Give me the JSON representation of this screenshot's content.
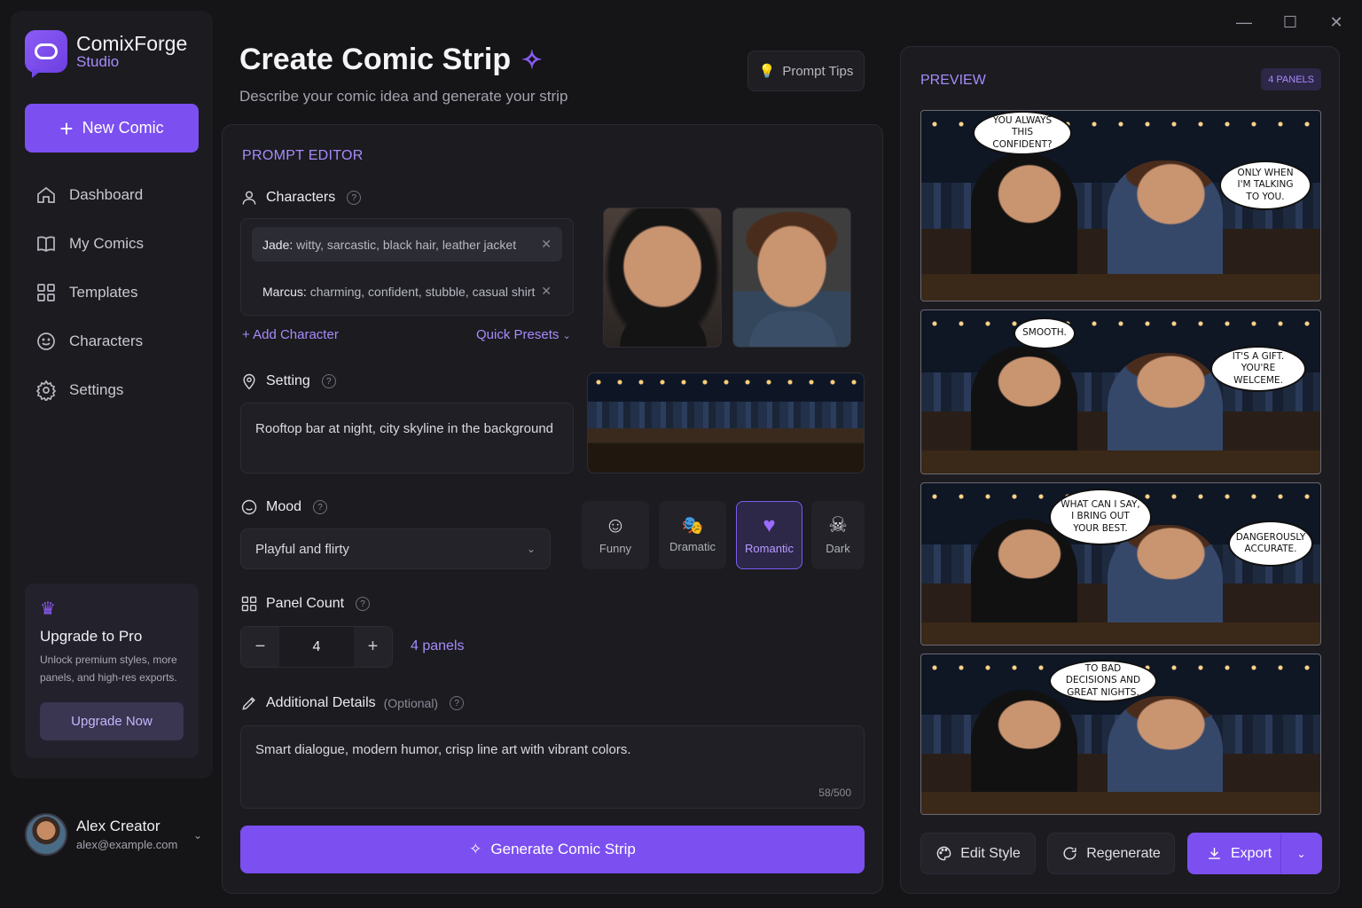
{
  "app": {
    "name": "ComixForge",
    "sub": "Studio"
  },
  "sidebar": {
    "new_label": "New Comic",
    "items": [
      {
        "label": "Dashboard",
        "icon": "home-icon"
      },
      {
        "label": "My Comics",
        "icon": "book-icon"
      },
      {
        "label": "Templates",
        "icon": "grid-icon"
      },
      {
        "label": "Characters",
        "icon": "smiley-icon"
      },
      {
        "label": "Settings",
        "icon": "gear-icon"
      }
    ],
    "upgrade": {
      "title": "Upgrade to Pro",
      "desc": "Unlock premium styles, more panels, and high-res exports.",
      "button": "Upgrade Now"
    },
    "user": {
      "name": "Alex Creator",
      "email": "alex@example.com"
    }
  },
  "header": {
    "title": "Create Comic Strip",
    "subtitle": "Describe your comic idea and generate your strip",
    "tips": "Prompt Tips"
  },
  "editor": {
    "title": "PROMPT EDITOR",
    "characters": {
      "label": "Characters",
      "list": [
        {
          "name": "Jade:",
          "desc": "witty, sarcastic, black hair, leather jacket"
        },
        {
          "name": "Marcus:",
          "desc": "charming, confident, stubble, casual shirt"
        }
      ],
      "add": "+ Add Character",
      "presets": "Quick Presets"
    },
    "setting": {
      "label": "Setting",
      "value": "Rooftop bar at night, city skyline in the background"
    },
    "mood": {
      "label": "Mood",
      "value": "Playful and flirty",
      "options": [
        {
          "label": "Funny",
          "icon": "☺"
        },
        {
          "label": "Dramatic",
          "icon": "🎭"
        },
        {
          "label": "Romantic",
          "icon": "♥"
        },
        {
          "label": "Dark",
          "icon": "☠"
        }
      ],
      "selected": "Romantic"
    },
    "panels": {
      "label": "Panel Count",
      "value": "4",
      "summary": "4 panels"
    },
    "details": {
      "label": "Additional Details",
      "optional": "(Optional)",
      "value": "Smart dialogue, modern humor, crisp line art with vibrant colors.",
      "counter": "58/500"
    },
    "generate": "Generate Comic Strip"
  },
  "preview": {
    "title": "PREVIEW",
    "badge": "4 PANELS",
    "panels": [
      {
        "left": "YOU ALWAYS THIS CONFIDENT?",
        "right": "ONLY WHEN I'M TALKING TO YOU."
      },
      {
        "left": "SMOOTH.",
        "right": "IT'S A GIFT. YOU'RE WELCEME."
      },
      {
        "left": "WHAT CAN I SAY, I BRING OUT YOUR BEST.",
        "right": "DANGEROUSLY ACCURATE."
      },
      {
        "left": "TO BAD DECISIONS AND GREAT NIGHTS.",
        "right": ""
      }
    ],
    "buttons": {
      "edit": "Edit Style",
      "regen": "Regenerate",
      "export": "Export"
    }
  },
  "colors": {
    "accent": "#7c4ff0",
    "accent_text": "#a78bfa",
    "bg": "#151518",
    "panel": "#1b1b20"
  }
}
